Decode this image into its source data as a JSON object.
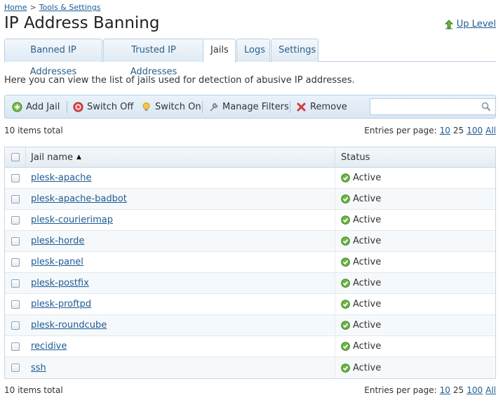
{
  "breadcrumb": {
    "home": "Home",
    "sep": ">",
    "tools": "Tools & Settings"
  },
  "page": {
    "title": "IP Address Banning",
    "up_level": "Up Level"
  },
  "tabs": [
    {
      "label": "Banned IP Addresses",
      "active": false
    },
    {
      "label": "Trusted IP Addresses",
      "active": false
    },
    {
      "label": "Jails",
      "active": true
    },
    {
      "label": "Logs",
      "active": false
    },
    {
      "label": "Settings",
      "active": false
    }
  ],
  "intro": "Here you can view the list of jails used for detection of abusive IP addresses.",
  "toolbar": {
    "add_jail": "Add Jail",
    "switch_off": "Switch Off",
    "switch_on": "Switch On",
    "manage_filters": "Manage Filters",
    "remove": "Remove",
    "search_placeholder": ""
  },
  "list_info": {
    "items_total": "10 items total",
    "entries_label": "Entries per page:",
    "options": [
      "10",
      "25",
      "100",
      "All"
    ],
    "current": "25"
  },
  "table": {
    "columns": [
      "Jail name",
      "Status"
    ],
    "sort": "ascending",
    "rows": [
      {
        "name": "plesk-apache",
        "status": "Active"
      },
      {
        "name": "plesk-apache-badbot",
        "status": "Active"
      },
      {
        "name": "plesk-courierimap",
        "status": "Active"
      },
      {
        "name": "plesk-horde",
        "status": "Active"
      },
      {
        "name": "plesk-panel",
        "status": "Active"
      },
      {
        "name": "plesk-postfix",
        "status": "Active"
      },
      {
        "name": "plesk-proftpd",
        "status": "Active"
      },
      {
        "name": "plesk-roundcube",
        "status": "Active"
      },
      {
        "name": "recidive",
        "status": "Active"
      },
      {
        "name": "ssh",
        "status": "Active"
      }
    ]
  },
  "colors": {
    "link": "#1e5b94",
    "active_green": "#5aa83a",
    "remove_red": "#d33c3c"
  }
}
